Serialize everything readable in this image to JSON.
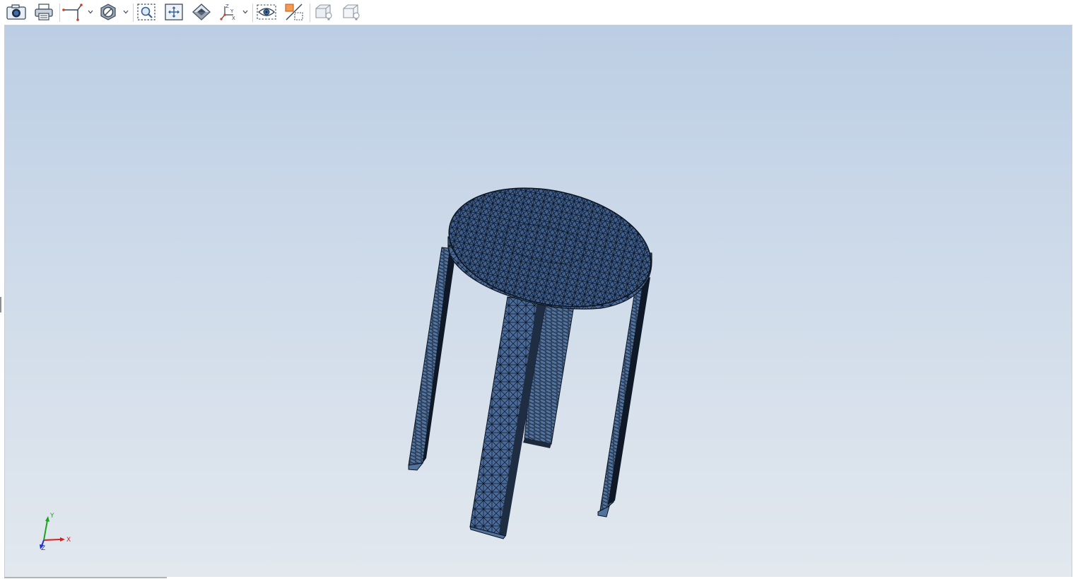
{
  "toolbar": {
    "buttons": [
      {
        "name": "camera-icon",
        "label": ""
      },
      {
        "name": "print-icon",
        "label": ""
      },
      {
        "name": "section-plane-icon",
        "label": ""
      },
      {
        "name": "hide-show-icon",
        "label": ""
      },
      {
        "name": "zoom-to-area-icon",
        "label": ""
      },
      {
        "name": "zoom-to-fit-icon",
        "label": ""
      },
      {
        "name": "rotate-view-icon",
        "label": ""
      },
      {
        "name": "view-orientation-icon",
        "label": ""
      },
      {
        "name": "visibility-eye-icon",
        "label": ""
      },
      {
        "name": "display-style-icon",
        "label": ""
      },
      {
        "name": "light-scene-icon",
        "label": ""
      },
      {
        "name": "light-box-icon",
        "label": ""
      }
    ]
  },
  "triad": {
    "x_label": "X",
    "y_label": "Y",
    "z_label": "Z",
    "colors": {
      "x": "#d62020",
      "y": "#1aa51a",
      "z": "#2030d0"
    }
  },
  "model": {
    "name": "stool mesh",
    "face_color": "#4a6a9a",
    "mesh_color": "#0b1420"
  },
  "viewport": {
    "gradient_top": "#bccee4",
    "gradient_bottom": "#e2e8ee"
  }
}
